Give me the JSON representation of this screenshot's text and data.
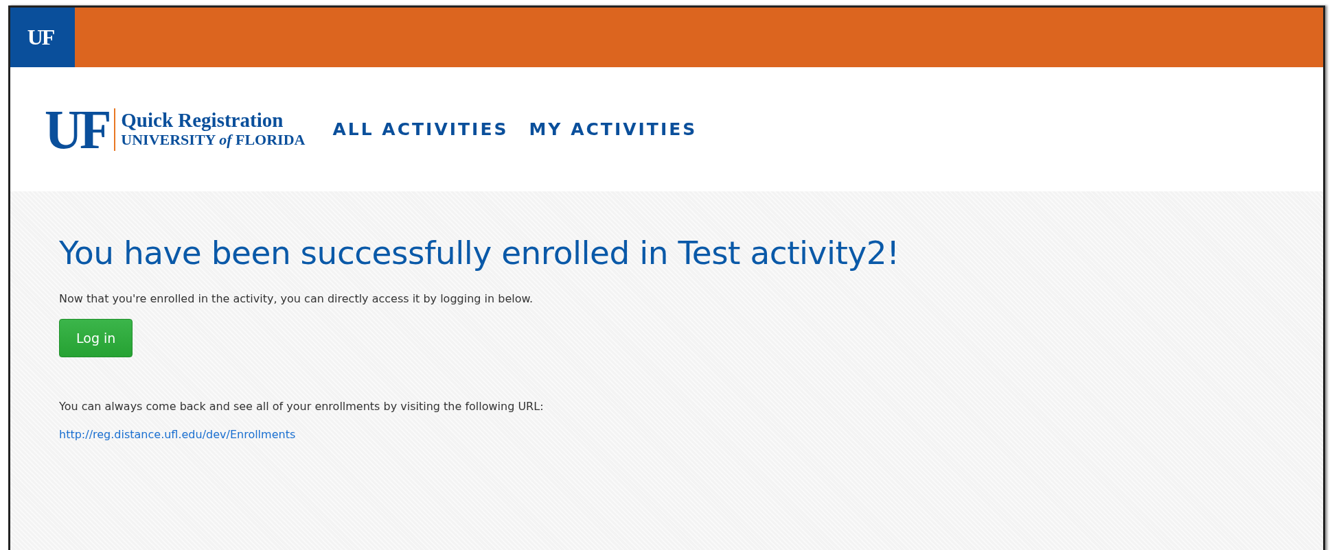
{
  "top_bar": {
    "logo": "UF"
  },
  "header": {
    "logo": {
      "mark": "UF",
      "title": "Quick Registration",
      "subtitle_before": "UNIVERSITY ",
      "subtitle_italic": "of",
      "subtitle_after": " FLORIDA"
    },
    "nav": [
      {
        "label": "ALL ACTIVITIES"
      },
      {
        "label": "MY ACTIVITIES"
      }
    ]
  },
  "content": {
    "heading": "You have been successfully enrolled in Test activity2!",
    "message": "Now that you're enrolled in the activity, you can directly access it by logging in below.",
    "button": "Log in",
    "note": "You can always come back and see all of your enrollments by visiting the following URL:",
    "link": "http://reg.distance.ufl.edu/dev/Enrollments"
  }
}
